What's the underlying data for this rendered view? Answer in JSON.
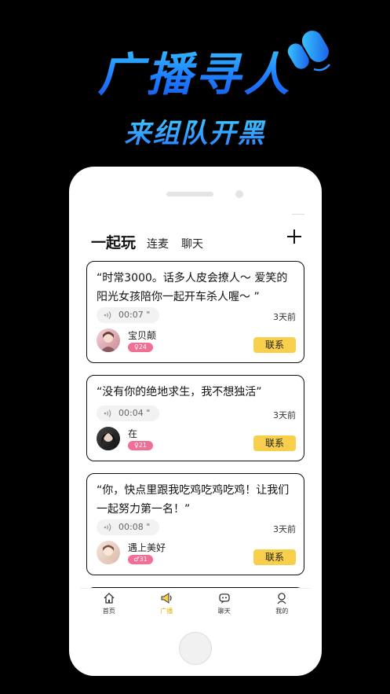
{
  "promo": {
    "title": "广播寻人",
    "subtitle": "来组队开黑",
    "speaker_icon": "megaphone-speaker-icon",
    "accent_color": "#1e7dff"
  },
  "header": {
    "main_tab": "一起玩",
    "tabs": [
      "连麦",
      "聊天"
    ],
    "add_icon": "plus-icon"
  },
  "posts": [
    {
      "text": "“时常3000。话多人皮会撩人～ 爱笑的阳光女孩陪你一起开车杀人喔～ ”",
      "duration": "00:07 \"",
      "time": "3天前",
      "username": "宝贝颠",
      "badge_icon": "female-icon",
      "badge_value": "24",
      "badge_color": "#f06f95",
      "contact_label": "联系"
    },
    {
      "text": "“没有你的绝地求生，我不想独活”",
      "duration": "00:04 \"",
      "time": "3天前",
      "username": "在",
      "badge_icon": "female-icon",
      "badge_value": "21",
      "badge_color": "#f06f95",
      "contact_label": "联系"
    },
    {
      "text": "“你，快点里跟我吃鸡吃鸡吃鸡！让我们一起努力第一名！”",
      "duration": "00:08 \"",
      "time": "3天前",
      "username": "遇上美好",
      "badge_icon": "male-icon",
      "badge_value": "31",
      "badge_color": "#f06f95",
      "contact_label": "联系"
    }
  ],
  "tabbar": {
    "items": [
      {
        "label": "首页",
        "icon": "home-icon"
      },
      {
        "label": "广播",
        "icon": "broadcast-icon"
      },
      {
        "label": "聊天",
        "icon": "chat-icon"
      },
      {
        "label": "我的",
        "icon": "profile-icon"
      }
    ],
    "active_color": "#e5b300"
  }
}
